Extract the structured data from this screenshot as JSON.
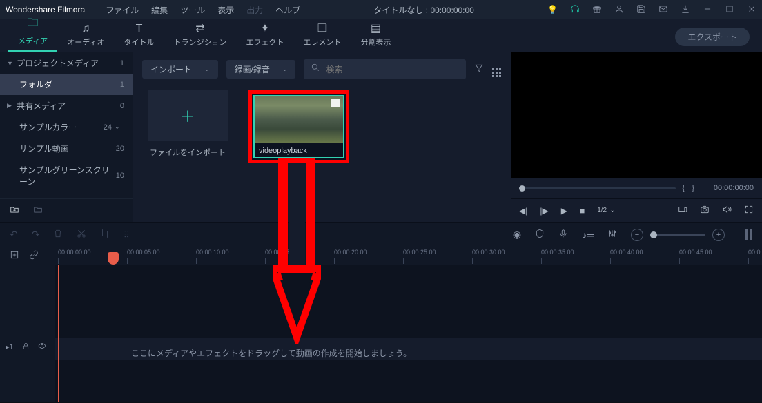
{
  "app": {
    "name": "Wondershare Filmora"
  },
  "menu": {
    "file": "ファイル",
    "edit": "編集",
    "tool": "ツール",
    "view": "表示",
    "output": "出力",
    "help": "ヘルプ"
  },
  "project": {
    "title": "タイトルなし",
    "timecode": "00:00:00:00"
  },
  "tabs": {
    "media": "メディア",
    "audio": "オーディオ",
    "title": "タイトル",
    "transition": "トランジション",
    "effect": "エフェクト",
    "element": "エレメント",
    "split": "分割表示",
    "export": "エクスポート"
  },
  "sidebar": {
    "items": [
      {
        "label": "プロジェクトメディア",
        "count": "1",
        "expand": true
      },
      {
        "label": "フォルダ",
        "count": "1",
        "selected": true
      },
      {
        "label": "共有メディア",
        "count": "0",
        "expand": false
      },
      {
        "label": "サンプルカラー",
        "count": "24",
        "arrow": true
      },
      {
        "label": "サンプル動画",
        "count": "20"
      },
      {
        "label": "サンプルグリーンスクリーン",
        "count": "10"
      }
    ]
  },
  "mediabar": {
    "import": "インポート",
    "record": "録画/録音",
    "search_placeholder": "検索"
  },
  "importTile": {
    "caption": "ファイルをインポート"
  },
  "clip": {
    "name": "videoplayback"
  },
  "preview": {
    "inmark": "{",
    "outmark": "}",
    "timecode": "00:00:00:00",
    "ratio": "1/2"
  },
  "ruler": {
    "times": [
      "00:00:00:00",
      "00:00:05:00",
      "00:00:10:00",
      "00:00:15:00",
      "00:00:20:00",
      "00:00:25:00",
      "00:00:30:00",
      "00:00:35:00",
      "00:00:40:00",
      "00:00:45:00",
      "00:0"
    ]
  },
  "timeline": {
    "hint": "ここにメディアやエフェクトをドラッグして動画の作成を開始しましょう。",
    "track_label": "1"
  }
}
